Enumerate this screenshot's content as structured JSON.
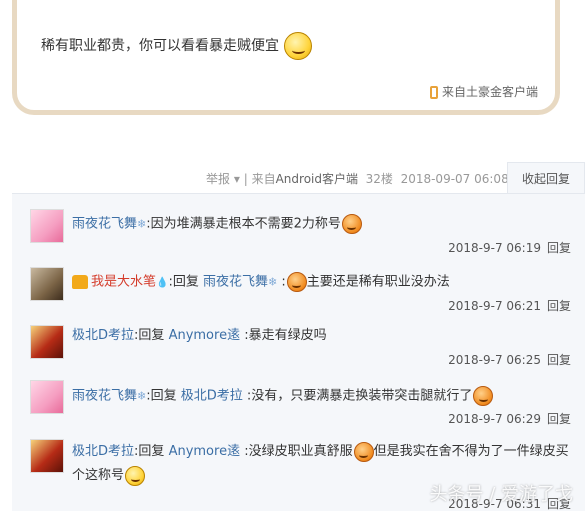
{
  "quote_card": {
    "text": "稀有职业都贵，你可以看看暴走贼便宜",
    "source": "来自土豪金客户端",
    "border_color": "#e8d9c2"
  },
  "post_meta": {
    "report": "举报",
    "separator": "|",
    "from_prefix": "来自",
    "client": "Android客户端",
    "floor": "32楼",
    "date": "2018-09-07 06:08",
    "collapse_label": "收起回复"
  },
  "replies": [
    {
      "user": "雨夜花飞舞",
      "user_suffix": "❄",
      "reply_to": "",
      "content_before": "因为堆满暴走根本不需要2力称号",
      "content_after": "",
      "time": "2018-9-7 06:19",
      "reply_label": "回复"
    },
    {
      "user": "我是大水笔",
      "user_suffix": "💧",
      "reply_prefix": "回复",
      "reply_to": "雨夜花飞舞",
      "reply_to_suffix": "❄",
      "content_before": "",
      "content_after": "主要还是稀有职业没办法",
      "time": "2018-9-7 06:21",
      "reply_label": "回复"
    },
    {
      "user": "极北D考拉",
      "reply_prefix": "回复",
      "reply_to": "Anymore逺",
      "content_before": "暴走有绿皮吗",
      "time": "2018-9-7 06:25",
      "reply_label": "回复"
    },
    {
      "user": "雨夜花飞舞",
      "user_suffix": "❄",
      "reply_prefix": "回复",
      "reply_to": "极北D考拉",
      "content_before": "没有，只要满暴走换装带突击腿就行了",
      "time": "2018-9-7 06:29",
      "reply_label": "回复"
    },
    {
      "user": "极北D考拉",
      "reply_prefix": "回复",
      "reply_to": "Anymore逺",
      "content_before": "没绿皮职业真舒服",
      "content_after": "但是我实在舍不得为了一件绿皮买个这称号",
      "time": "2018-9-7 06:31",
      "reply_label": "回复"
    }
  ],
  "colors": {
    "username": "#3b6ea5",
    "vip_username": "#d43b2a",
    "reply_bg": "#f5f7fa"
  },
  "watermark": "头条号 / 爱游了戈",
  "icons": [
    "smile-emoji-icon",
    "phone-icon",
    "dropdown-arrow-icon",
    "snowflake-icon",
    "crown-vip-icon",
    "water-drop-icon"
  ]
}
